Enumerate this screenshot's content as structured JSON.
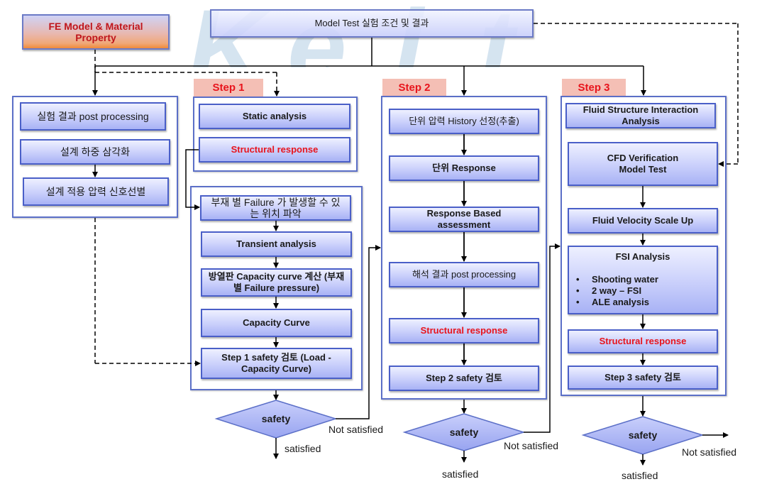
{
  "watermark": {
    "text": "KEIT",
    "logo_letters": [
      "K",
      "e",
      "i",
      "t"
    ]
  },
  "top": {
    "fe_model": "FE Model & Material Property",
    "model_test": "Model Test 실험 조건 및 결과"
  },
  "left_group": {
    "items": [
      "실험 결과 post processing",
      "설계 하중 삼각화",
      "설계 적용 압력 신호선별"
    ]
  },
  "step1": {
    "tag": "Step 1",
    "upper": [
      "Static analysis",
      "Structural response"
    ],
    "lower": [
      "부재 별 Failure 가 발생할 수 있는 위치 파악",
      "Transient analysis",
      "방열판 Capacity curve 계산 (부재별 Failure pressure)",
      "Capacity Curve",
      "Step 1 safety 검토 (Load - Capacity Curve)"
    ],
    "decision": {
      "label": "safety",
      "no": "Not satisfied",
      "yes": "satisfied"
    }
  },
  "step2": {
    "tag": "Step 2",
    "items": [
      "단위 압력 History 선정(추출)",
      "단위 Response",
      "Response Based assessment",
      "해석 결과 post processing",
      "Structural response",
      "Step 2 safety 검토"
    ],
    "decision": {
      "label": "safety",
      "no": "Not satisfied",
      "yes": "satisfied"
    }
  },
  "step3": {
    "tag": "Step 3",
    "items": [
      "Fluid Structure Interaction Analysis",
      "CFD Verification Model Test",
      "Fluid Velocity Scale Up"
    ],
    "fsi": {
      "title": "FSI Analysis",
      "bullets": [
        "Shooting water",
        "2 way – FSI",
        "ALE analysis"
      ]
    },
    "after": [
      "Structural response",
      "Step 3 safety 검토"
    ],
    "decision": {
      "label": "safety",
      "no": "Not satisfied",
      "yes": "satisfied"
    }
  },
  "colors": {
    "box_border": "#4a5fc8",
    "box_fill_top": "#eef0ff",
    "box_fill_bottom": "#a8b2f5",
    "highlight_text": "#e8141c",
    "step_tag_bg": "#f4bfb5",
    "fe_gradient_bottom": "#f08a3a"
  },
  "bullet_symbol": "•"
}
